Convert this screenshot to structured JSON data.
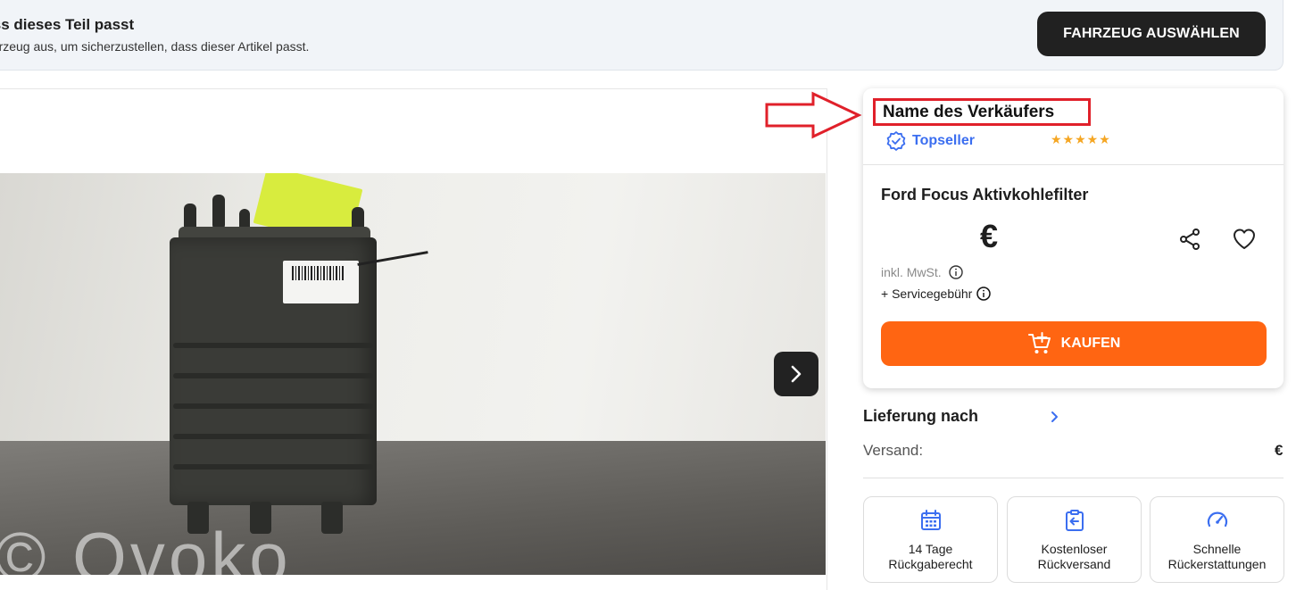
{
  "banner": {
    "title": "e, dass dieses Teil passt",
    "subtitle": "ahrzeug aus, um sicherzustellen, dass dieser Artikel passt.",
    "button_label": "FAHRZEUG AUSWÄHLEN"
  },
  "gallery": {
    "watermark_text": "© Ovoko",
    "next_icon": "chevron-right-icon"
  },
  "seller": {
    "name": "Name des Verkäufers",
    "badge": "Topseller",
    "badge_icon": "verified-badge-icon",
    "rating_stars": "★★★★★",
    "rating": 5,
    "highlight_color": "#e0202a"
  },
  "product": {
    "title": "Ford Focus Aktivkohlefilter",
    "price": "€",
    "vat_note": "inkl. MwSt.",
    "service_fee": "+ Servicegebühr",
    "buy_label": "KAUFEN",
    "buy_color": "#ff6512"
  },
  "delivery": {
    "title": "Lieferung nach",
    "shipping_label": "Versand:",
    "shipping_value": "€"
  },
  "features": [
    {
      "icon": "calendar-icon",
      "line1": "14 Tage",
      "line2": "Rückgaberecht"
    },
    {
      "icon": "return-box-icon",
      "line1": "Kostenloser",
      "line2": "Rückversand"
    },
    {
      "icon": "speedometer-icon",
      "line1": "Schnelle",
      "line2": "Rückerstattungen"
    }
  ],
  "accent_color": "#3b6ef0"
}
